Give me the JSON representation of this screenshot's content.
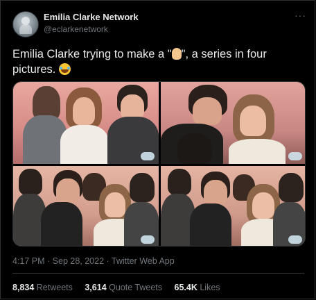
{
  "tweet": {
    "display_name": "Emilia Clarke Network",
    "handle": "@eclarkenetwork",
    "more_icon": "more-dots-icon",
    "text_before": "Emilia Clarke trying to make a \"",
    "text_middle": "\", a series in four pictures.",
    "emoji_1": "pinched-fingers-emoji",
    "emoji_2": "laughing-tears-emoji",
    "photos_count": 4,
    "timestamp": "4:17 PM · Sep 28, 2022 · Twitter Web App",
    "retweets_count": "8,834",
    "retweets_label": "Retweets",
    "quotes_count": "3,614",
    "quotes_label": "Quote Tweets",
    "likes_count": "65.4K",
    "likes_label": "Likes"
  },
  "colors": {
    "background": "#000000",
    "text": "#e7e9ea",
    "secondary": "#71767b",
    "border": "#2f3336"
  }
}
